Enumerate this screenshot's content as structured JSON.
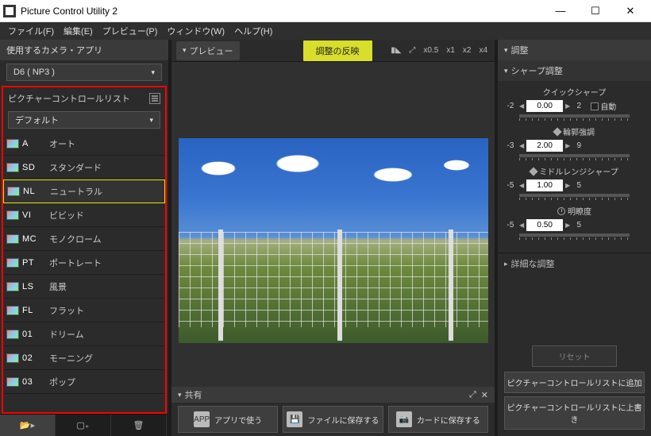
{
  "window": {
    "title": "Picture Control Utility 2",
    "min": "—",
    "max": "☐",
    "close": "✕"
  },
  "menu": {
    "file": "ファイル(F)",
    "edit": "編集(E)",
    "preview": "プレビュー(P)",
    "window": "ウィンドウ(W)",
    "help": "ヘルプ(H)"
  },
  "left": {
    "cameraAppLabel": "使用するカメラ・アプリ",
    "cameraAppValue": "D6 ( NP3 )",
    "pclTitle": "ピクチャーコントロールリスト",
    "pclGroup": "デフォルト",
    "items": [
      {
        "code": "A",
        "name": "オート"
      },
      {
        "code": "SD",
        "name": "スタンダード"
      },
      {
        "code": "NL",
        "name": "ニュートラル",
        "selected": true
      },
      {
        "code": "VI",
        "name": "ビビッド"
      },
      {
        "code": "MC",
        "name": "モノクローム"
      },
      {
        "code": "PT",
        "name": "ポートレート"
      },
      {
        "code": "LS",
        "name": "風景"
      },
      {
        "code": "FL",
        "name": "フラット"
      },
      {
        "code": "01",
        "name": "ドリーム"
      },
      {
        "code": "02",
        "name": "モーニング"
      },
      {
        "code": "03",
        "name": "ポップ"
      }
    ]
  },
  "mid": {
    "previewTab": "プレビュー",
    "reflectBtn": "調整の反映",
    "zoom": {
      "half": "x0.5",
      "one": "x1",
      "two": "x2",
      "four": "x4"
    },
    "shareTitle": "共有",
    "shareBtns": {
      "app": "アプリで使う",
      "file": "ファイルに保存する",
      "card": "カードに保存する"
    }
  },
  "right": {
    "adjustTitle": "調整",
    "sharpTitle": "シャープ調整",
    "sliders": {
      "quick": {
        "label": "クイックシャープ",
        "min": "-2",
        "max": "2",
        "value": "0.00",
        "autoLabel": "自動"
      },
      "edge": {
        "label": "輪郭強調",
        "min": "-3",
        "max": "9",
        "value": "2.00"
      },
      "midrange": {
        "label": "ミドルレンジシャープ",
        "min": "-5",
        "max": "5",
        "value": "1.00"
      },
      "clarity": {
        "label": "明瞭度",
        "min": "-5",
        "max": "5",
        "value": "0.50"
      }
    },
    "detailTitle": "詳細な調整",
    "resetBtn": "リセット",
    "addBtn": "ピクチャーコントロールリストに追加",
    "overwriteBtn": "ピクチャーコントロールリストに上書き"
  }
}
